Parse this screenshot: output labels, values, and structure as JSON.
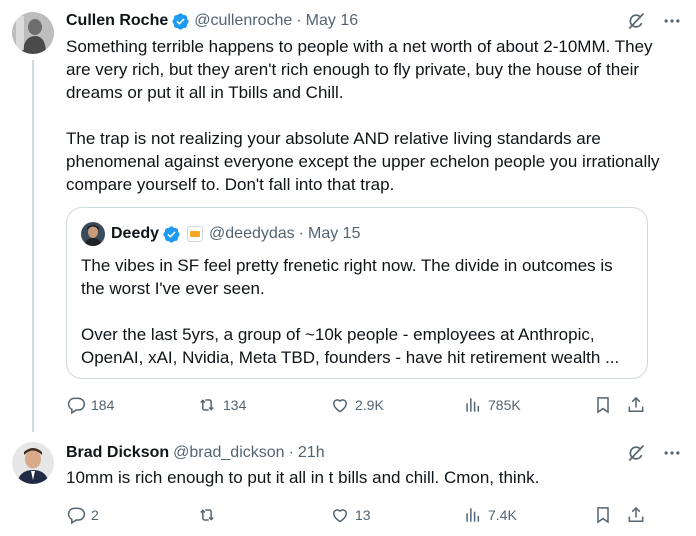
{
  "tweet1": {
    "author_name": "Cullen Roche",
    "handle": "@cullenroche",
    "separator": "·",
    "time": "May 16",
    "paragraphs": [
      "Something terrible happens to people with a net worth of about 2-10MM. They are very rich, but they aren't rich enough to fly private, buy the house of their dreams or put it all in Tbills and Chill.",
      "The trap is not realizing your absolute AND relative living standards are phenomenal against everyone except the upper echelon people you irrationally compare yourself to. Don't fall into that trap."
    ],
    "quote": {
      "author_name": "Deedy",
      "handle": "@deedydas",
      "separator": "·",
      "time": "May 15",
      "lines": [
        "The vibes in SF feel pretty frenetic right now. The divide in outcomes is",
        "the worst I've ever seen.",
        "",
        "Over the last 5yrs, a group of ~10k people - employees at Anthropic,",
        "OpenAI, xAI, Nvidia, Meta TBD, founders - have hit retirement wealth ..."
      ]
    },
    "stats": {
      "replies": "184",
      "reposts": "134",
      "likes": "2.9K",
      "views": "785K"
    }
  },
  "tweet2": {
    "author_name": "Brad Dickson",
    "handle": "@brad_dickson",
    "separator": "·",
    "time": "21h",
    "text": "10mm is rich enough to put it all in t bills and chill. Cmon, think.",
    "stats": {
      "replies": "2",
      "reposts": "",
      "likes": "13",
      "views": "7.4K"
    }
  },
  "colors": {
    "text": "#0f1419",
    "secondary": "#536471",
    "verified": "#1d9bf0",
    "border": "#cfd9de"
  },
  "icons": [
    "verified-badge-icon",
    "grok-icon",
    "more-icon",
    "reply-icon",
    "repost-icon",
    "like-icon",
    "views-icon",
    "bookmark-icon",
    "share-icon"
  ]
}
